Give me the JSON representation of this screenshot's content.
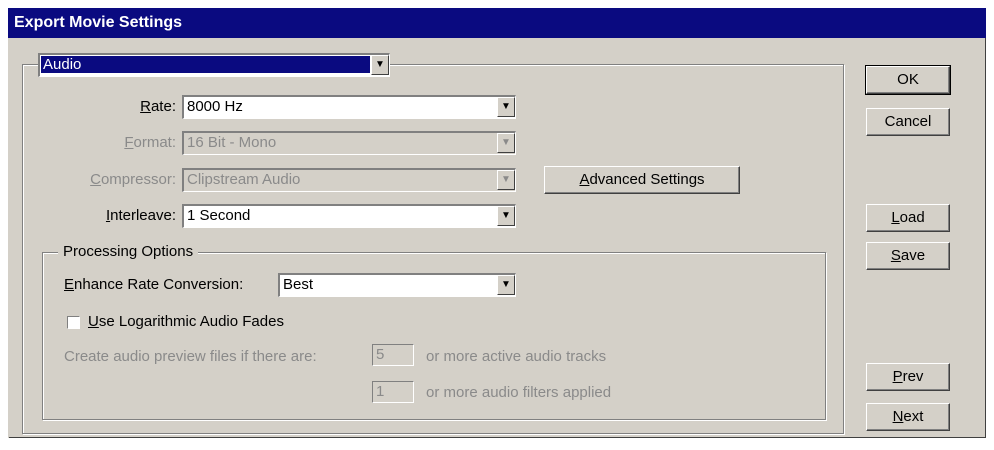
{
  "window": {
    "title": "Export Movie Settings"
  },
  "section_select": {
    "value": "Audio"
  },
  "fields": {
    "rate": {
      "label_pre": "",
      "label_key": "R",
      "label_post": "ate:",
      "value": "8000 Hz"
    },
    "format": {
      "label_pre": "",
      "label_key": "F",
      "label_post": "ormat:",
      "value": "16 Bit - Mono"
    },
    "compressor": {
      "label_pre": "",
      "label_key": "C",
      "label_post": "ompressor:",
      "value": "Clipstream Audio"
    },
    "interleave": {
      "label_pre": "",
      "label_key": "I",
      "label_post": "nterleave:",
      "value": "1 Second"
    }
  },
  "advanced_settings": {
    "pre": "",
    "key": "A",
    "post": "dvanced Settings"
  },
  "processing": {
    "legend": "Processing Options",
    "enhance": {
      "label_pre": "",
      "label_key": "E",
      "label_post": "nhance Rate Conversion:",
      "value": "Best"
    },
    "log_fades": {
      "label_pre": "",
      "label_key": "U",
      "label_post": "se Logarithmic Audio Fades",
      "checked": false
    },
    "preview_line1": {
      "prefix": "Create audio preview files if there are:",
      "value": "5",
      "suffix": "or more active audio tracks"
    },
    "preview_line2": {
      "value": "1",
      "suffix": "or more audio filters applied"
    }
  },
  "buttons": {
    "ok": {
      "pre": "OK",
      "key": "",
      "post": ""
    },
    "cancel": {
      "pre": "Cancel",
      "key": "",
      "post": ""
    },
    "load": {
      "pre": "",
      "key": "L",
      "post": "oad"
    },
    "save": {
      "pre": "",
      "key": "S",
      "post": "ave"
    },
    "prev": {
      "pre": "",
      "key": "P",
      "post": "rev"
    },
    "next": {
      "pre": "",
      "key": "N",
      "post": "ext"
    }
  }
}
